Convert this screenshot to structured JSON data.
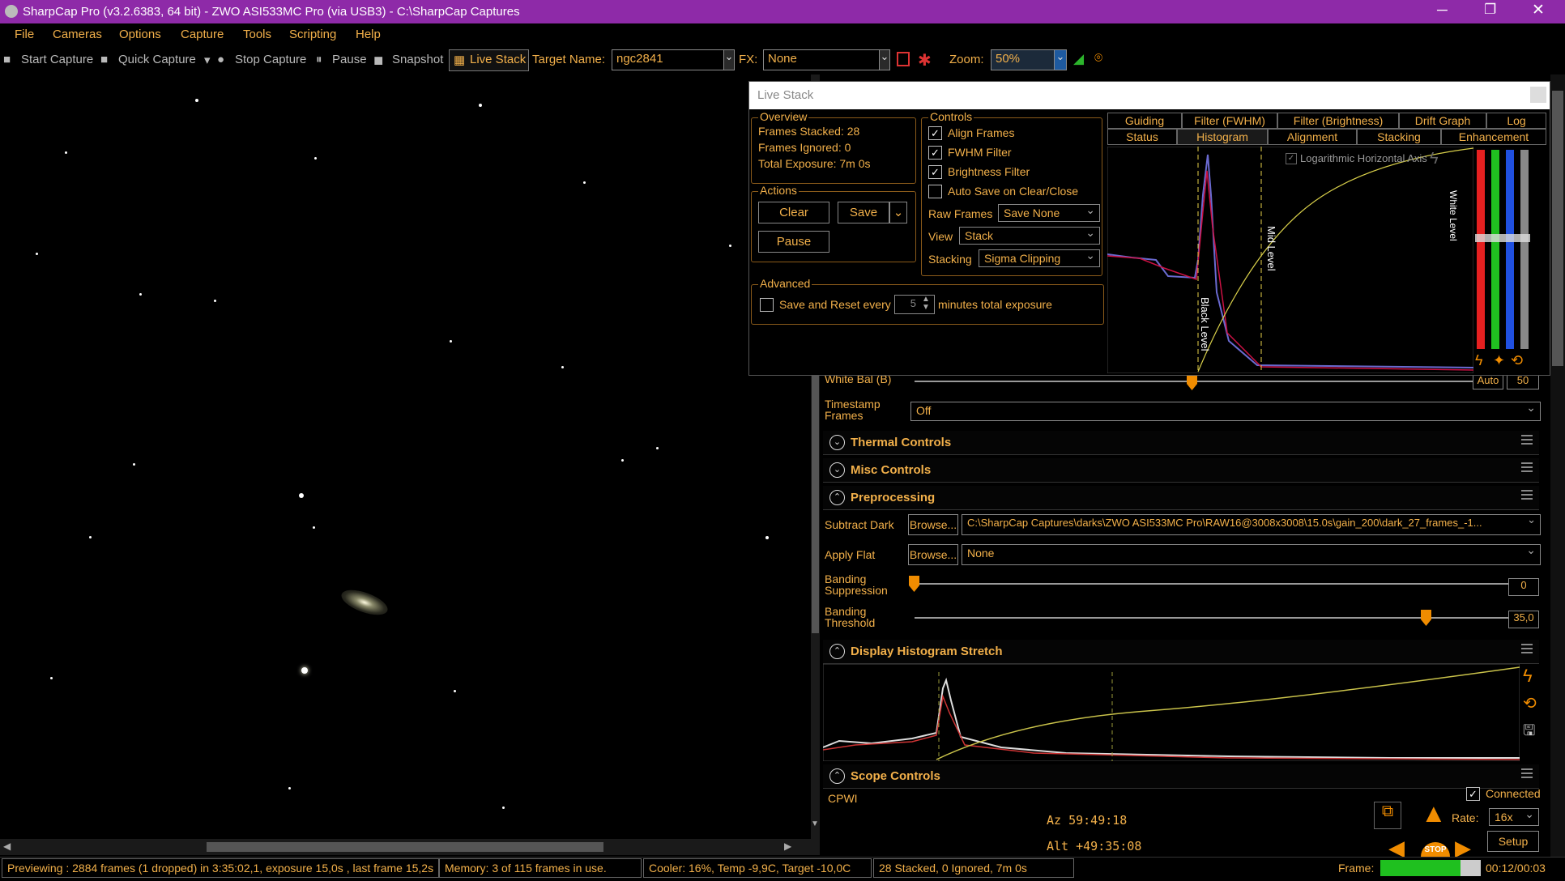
{
  "window": {
    "title": "SharpCap Pro (v3.2.6383, 64 bit) - ZWO ASI533MC Pro (via USB3) - C:\\SharpCap Captures"
  },
  "menu": [
    "File",
    "Cameras",
    "Options",
    "Capture",
    "Tools",
    "Scripting",
    "Help"
  ],
  "toolbar": {
    "start_capture": "Start Capture",
    "quick_capture": "Quick Capture",
    "stop_capture": "Stop Capture",
    "pause": "Pause",
    "snapshot": "Snapshot",
    "live_stack": "Live Stack",
    "target_label": "Target Name:",
    "target_value": "ngc2841",
    "fx_label": "FX:",
    "fx_value": "None",
    "zoom_label": "Zoom:",
    "zoom_value": "50%"
  },
  "livestack": {
    "title": "Live Stack",
    "overview": {
      "title": "Overview",
      "frames_stacked": "Frames Stacked: 28",
      "frames_ignored": "Frames Ignored:  0",
      "total_exposure": "Total Exposure:   7m 0s"
    },
    "actions": {
      "title": "Actions",
      "clear": "Clear",
      "save": "Save",
      "pause": "Pause"
    },
    "advanced": {
      "title": "Advanced",
      "save_reset": "Save and Reset every",
      "minutes_value": "5",
      "minutes_label": "minutes total exposure"
    },
    "controls": {
      "title": "Controls",
      "align_frames": "Align Frames",
      "fwhm_filter": "FWHM Filter",
      "brightness_filter": "Brightness Filter",
      "auto_save": "Auto Save on Clear/Close",
      "raw_frames_label": "Raw Frames",
      "raw_frames_value": "Save None",
      "view_label": "View",
      "view_value": "Stack",
      "stacking_label": "Stacking",
      "stacking_value": "Sigma Clipping"
    },
    "tabs_row1": [
      "Guiding",
      "Filter (FWHM)",
      "Filter (Brightness)",
      "Drift Graph",
      "Log"
    ],
    "tabs_row2": [
      "Status",
      "Histogram",
      "Alignment",
      "Stacking",
      "Enhancement"
    ],
    "histogram": {
      "log_axis": "Logarithmic Horizontal Axis",
      "black_level": "Black Level",
      "mid_level": "Mid Level",
      "white_level": "White Level"
    }
  },
  "panel": {
    "white_bal_label": "White Bal (B)",
    "auto": "Auto",
    "wb_value": "50",
    "timestamp_label": "Timestamp Frames",
    "timestamp_value": "Off",
    "sections": {
      "thermal": "Thermal Controls",
      "misc": "Misc Controls",
      "preprocessing": "Preprocessing",
      "display_stretch": "Display Histogram Stretch",
      "scope": "Scope Controls"
    },
    "subtract_dark_label": "Subtract Dark",
    "browse": "Browse...",
    "dark_path": "C:\\SharpCap Captures\\darks\\ZWO ASI533MC Pro\\RAW16@3008x3008\\15.0s\\gain_200\\dark_27_frames_-1...",
    "apply_flat_label": "Apply Flat",
    "flat_value": "None",
    "banding_suppression_label": "Banding Suppression",
    "banding_suppression_value": "0",
    "banding_threshold_label": "Banding Threshold",
    "banding_threshold_value": "35,0",
    "scope": {
      "mount": "CPWI",
      "az": "Az  59:49:18",
      "alt": "Alt +49:35:08",
      "connected": "Connected",
      "rate_label": "Rate:",
      "rate_value": "16x",
      "setup": "Setup",
      "stop": "STOP"
    }
  },
  "status": {
    "preview": "Previewing : 2884 frames (1 dropped) in 3:35:02,1, exposure 15,0s , last frame 15,2s",
    "memory": "Memory: 3 of 115 frames in use.",
    "cooler": "Cooler: 16%, Temp -9,9C, Target -10,0C",
    "stacked": "28 Stacked, 0 Ignored, 7m 0s",
    "frame_label": "Frame:",
    "frame_time": "00:12/00:03"
  },
  "colors": {
    "title_bar": "#8e2aa8",
    "accent": "#f2b04a",
    "slider_knob": "#f08c00",
    "frame_progress": "#1fc01f"
  }
}
